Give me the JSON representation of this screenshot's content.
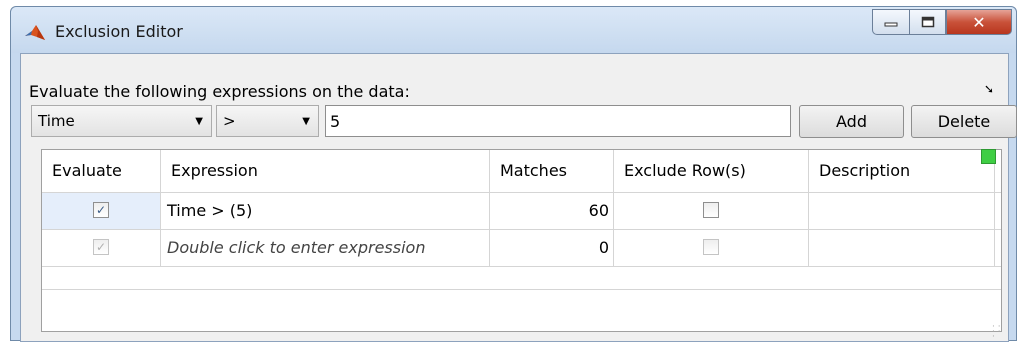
{
  "window": {
    "title": "Exclusion Editor"
  },
  "prompt": "Evaluate the following expressions on the data:",
  "controls": {
    "variable_combo": "Time",
    "operator_combo": ">",
    "value_field": "5",
    "add_label": "Add",
    "delete_label": "Delete"
  },
  "table": {
    "headers": [
      "Evaluate",
      "Expression",
      "Matches",
      "Exclude Row(s)",
      "Description"
    ],
    "rows": [
      {
        "evaluate": true,
        "expression": "Time > (5)",
        "matches": "60",
        "exclude": false,
        "description": ""
      },
      {
        "evaluate": true,
        "expression": "Double click to enter expression",
        "matches": "0",
        "exclude": false,
        "description": ""
      }
    ]
  },
  "icons": {
    "title": "matlab-logo-icon",
    "minimize": "minimize-icon",
    "maximize": "maximize-icon",
    "close": "close-icon"
  },
  "colors": {
    "status_indicator": "#3fce44",
    "selected_row": "#e5eefb"
  }
}
